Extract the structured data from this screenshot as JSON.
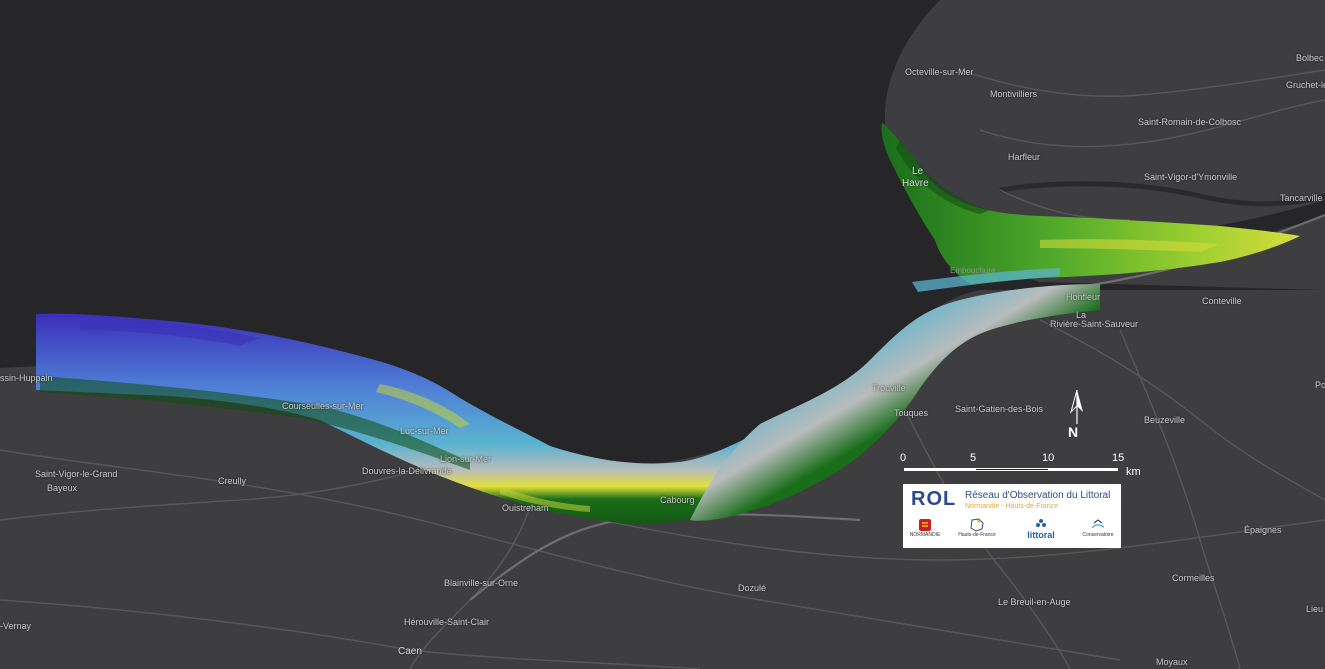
{
  "map": {
    "colors": {
      "sea": "#262629",
      "land": "#3e3e41",
      "road": "#58585c",
      "elev_deep": "#3b2fb8",
      "elev_shallow": "#5bb3cf",
      "elev_beach": "#b8bcbc",
      "elev_low": "#1a6e1a",
      "elev_mid": "#7bc62d",
      "elev_high": "#e3e03a"
    },
    "places": {
      "octeville": "Octeville-sur-Mer",
      "montivilliers": "Montivilliers",
      "bolbec": "Bolbec",
      "gruchet": "Gruchet-le-Valasse",
      "saint_romain": "Saint-Romain-de-Colbosc",
      "harfleur": "Harfleur",
      "le": "Le",
      "havre": "Havre",
      "saint_vigor_ymonville": "Saint-Vigor-d'Ymonville",
      "tancarville": "Tancarville",
      "embouchure": "Embouchure",
      "honfleur": "Honfleur",
      "conteville": "Conteville",
      "la": "La",
      "riviere": "Rivière-Saint-Sauveur",
      "ussin": "ssin-Huppain",
      "courseulles": "Courseulles-sur-Mer",
      "luc": "Luc-sur-Mer",
      "lion": "Lion-sur-Mer",
      "douvres": "Douvres-la-Délivrande",
      "trouville": "Trouville",
      "touques": "Touques",
      "saint_gatien": "Saint-Gatien-des-Bois",
      "beuzeville": "Beuzeville",
      "saint_vigor_grand": "Saint-Vigor-le-Grand",
      "bayeux": "Bayeux",
      "creully": "Creully",
      "ouistreham": "Ouistreham",
      "cabourg": "Cabourg",
      "epaignes": "Épaignes",
      "blainville": "Blainville-sur-Orne",
      "dozule": "Dozulé",
      "cormeilles": "Cormeilles",
      "le_breuil": "Le Breuil-en-Auge",
      "herouville": "Hérouville-Saint-Clair",
      "caen": "Caen",
      "vernay": "-Vernay",
      "moyaux": "Moyaux",
      "lieu": "Lieu",
      "po": "Po"
    },
    "north_arrow": "N",
    "scale": {
      "ticks": [
        "0",
        "5",
        "10",
        "15"
      ],
      "unit": "km"
    },
    "logo": {
      "mark": "ROL",
      "title": "Réseau d'Observation du Littoral",
      "subtitle": "Normandie - Hauts-de-France",
      "partners": [
        "NORMANDIE",
        "Hauts-de-France",
        "littoral",
        "Conservatoire"
      ]
    }
  }
}
